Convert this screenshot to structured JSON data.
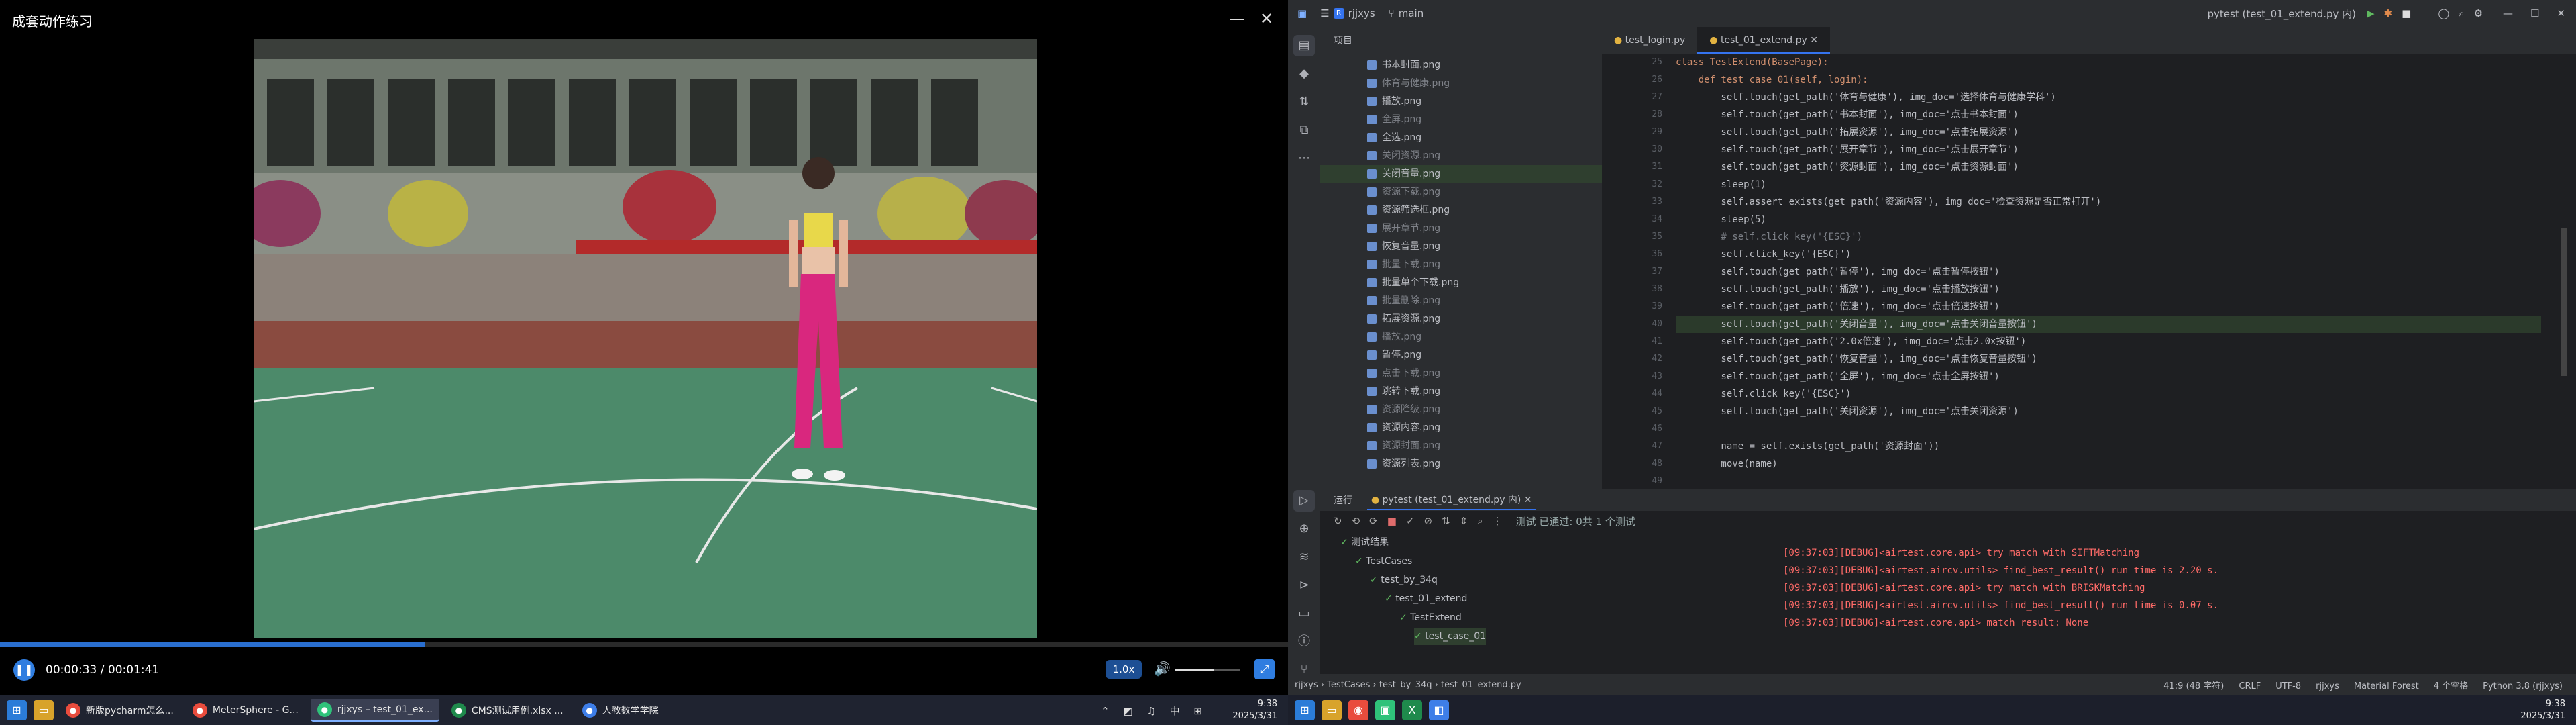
{
  "player": {
    "title": "成套动作练习",
    "minimize": "—",
    "close": "✕",
    "time": "00:00:33 / 00:01:41",
    "progress": 0.33,
    "speed": "1.0x",
    "volume": 0.6
  },
  "taskbar_left": {
    "apps": [
      {
        "label": "新版pycharm怎么...",
        "color": "#e94c3d",
        "active": false
      },
      {
        "label": "MeterSphere - G...",
        "color": "#e94c3d",
        "active": false
      },
      {
        "label": "rjjxys – test_01_ex...",
        "color": "#2fc27a",
        "active": true
      },
      {
        "label": "CMS测试用例.xlsx ...",
        "color": "#1f8a4c",
        "active": false
      },
      {
        "label": "人教数学学院",
        "color": "#3e7ee8",
        "active": false
      }
    ],
    "tray_icons": "⌃ ◩ ♫ 中 ⊞",
    "time": "9:38",
    "date": "2025/3/31"
  },
  "taskbar_right": {
    "time": "9:38",
    "date": "2025/3/31"
  },
  "ide": {
    "project_chip": "R",
    "project": "rjjxys",
    "branch": "main",
    "run_config": "pytest (test_01_extend.py 内)",
    "project_label": "项目",
    "files": [
      "书本封面.png",
      "体育与健康.png",
      "播放.png",
      "全屏.png",
      "全选.png",
      "关闭资源.png",
      "关闭音量.png",
      "资源下载.png",
      "资源筛选框.png",
      "展开章节.png",
      "恢复音量.png",
      "批量下载.png",
      "批量单个下载.png",
      "批量删除.png",
      "拓展资源.png",
      "播放.png",
      "暂停.png",
      "点击下载.png",
      "跳转下载.png",
      "资源降级.png",
      "资源内容.png",
      "资源封面.png",
      "资源列表.png"
    ],
    "tabs": [
      "test_login.py",
      "test_01_extend.py"
    ],
    "line_numbers": [
      "25",
      "26",
      "27",
      "28",
      "29",
      "30",
      "31",
      "32",
      "33",
      "34",
      "35",
      "36",
      "37",
      "38",
      "39",
      "40",
      "41",
      "42",
      "43",
      "44",
      "45",
      "46",
      "47",
      "48",
      "49"
    ],
    "code": [
      {
        "t": "class TestExtend(BasePage):",
        "cls": "kw"
      },
      {
        "t": "    def test_case_01(self, login):",
        "cls": "kw"
      },
      {
        "t": "        self.touch(get_path('体育与健康'), img_doc='选择体育与健康学科')",
        "cls": ""
      },
      {
        "t": "        self.touch(get_path('书本封面'), img_doc='点击书本封面')",
        "cls": ""
      },
      {
        "t": "        self.touch(get_path('拓展资源'), img_doc='点击拓展资源')",
        "cls": ""
      },
      {
        "t": "        self.touch(get_path('展开章节'), img_doc='点击展开章节')",
        "cls": ""
      },
      {
        "t": "        self.touch(get_path('资源封面'), img_doc='点击资源封面')",
        "cls": ""
      },
      {
        "t": "        sleep(1)",
        "cls": ""
      },
      {
        "t": "        self.assert_exists(get_path('资源内容'), img_doc='检查资源是否正常打开')",
        "cls": ""
      },
      {
        "t": "        sleep(5)",
        "cls": ""
      },
      {
        "t": "        # self.click_key('{ESC}')",
        "cls": "cm"
      },
      {
        "t": "        self.click_key('{ESC}')",
        "cls": ""
      },
      {
        "t": "        self.touch(get_path('暂停'), img_doc='点击暂停按钮')",
        "cls": ""
      },
      {
        "t": "        self.touch(get_path('播放'), img_doc='点击播放按钮')",
        "cls": ""
      },
      {
        "t": "        self.touch(get_path('倍速'), img_doc='点击倍速按钮')",
        "cls": ""
      },
      {
        "t": "        self.touch(get_path('关闭音量'), img_doc='点击关闭音量按钮')",
        "cls": "hl"
      },
      {
        "t": "        self.touch(get_path('2.0x倍速'), img_doc='点击2.0x按钮')",
        "cls": ""
      },
      {
        "t": "        self.touch(get_path('恢复音量'), img_doc='点击恢复音量按钮')",
        "cls": ""
      },
      {
        "t": "        self.touch(get_path('全屏'), img_doc='点击全屏按钮')",
        "cls": ""
      },
      {
        "t": "        self.click_key('{ESC}')",
        "cls": ""
      },
      {
        "t": "        self.touch(get_path('关闭资源'), img_doc='点击关闭资源')",
        "cls": ""
      },
      {
        "t": "",
        "cls": ""
      },
      {
        "t": "        name = self.exists(get_path('资源封面'))",
        "cls": ""
      },
      {
        "t": "        move(name)",
        "cls": ""
      }
    ],
    "run_label": "运行",
    "run_tab": "pytest (test_01_extend.py 内)",
    "run_status": "测试 已通过: 0共 1 个测试",
    "tree": [
      {
        "label": "测试结果",
        "indent": 0
      },
      {
        "label": "TestCases",
        "indent": 1
      },
      {
        "label": "test_by_34q",
        "indent": 2
      },
      {
        "label": "test_01_extend",
        "indent": 3
      },
      {
        "label": "TestExtend",
        "indent": 4
      },
      {
        "label": "test_case_01",
        "indent": 5
      }
    ],
    "logs": [
      "[09:37:03][DEBUG]<airtest.core.api> try match with SIFTMatching",
      "[09:37:03][DEBUG]<airtest.aircv.utils> find_best_result() run time is 2.20 s.",
      "[09:37:03][DEBUG]<airtest.core.api> try match with BRISKMatching",
      "[09:37:03][DEBUG]<airtest.aircv.utils> find_best_result() run time is 0.07 s.",
      "[09:37:03][DEBUG]<airtest.core.api> match result: None"
    ],
    "breadcrumb": [
      "rjjxys",
      "TestCases",
      "test_by_34q",
      "test_01_extend.py"
    ],
    "status_right": [
      "41:9 (48 字符)",
      "CRLF",
      "UTF-8",
      "rjjxys",
      "Material Forest",
      "4 个空格",
      "Python 3.8 (rjjxys)"
    ]
  }
}
